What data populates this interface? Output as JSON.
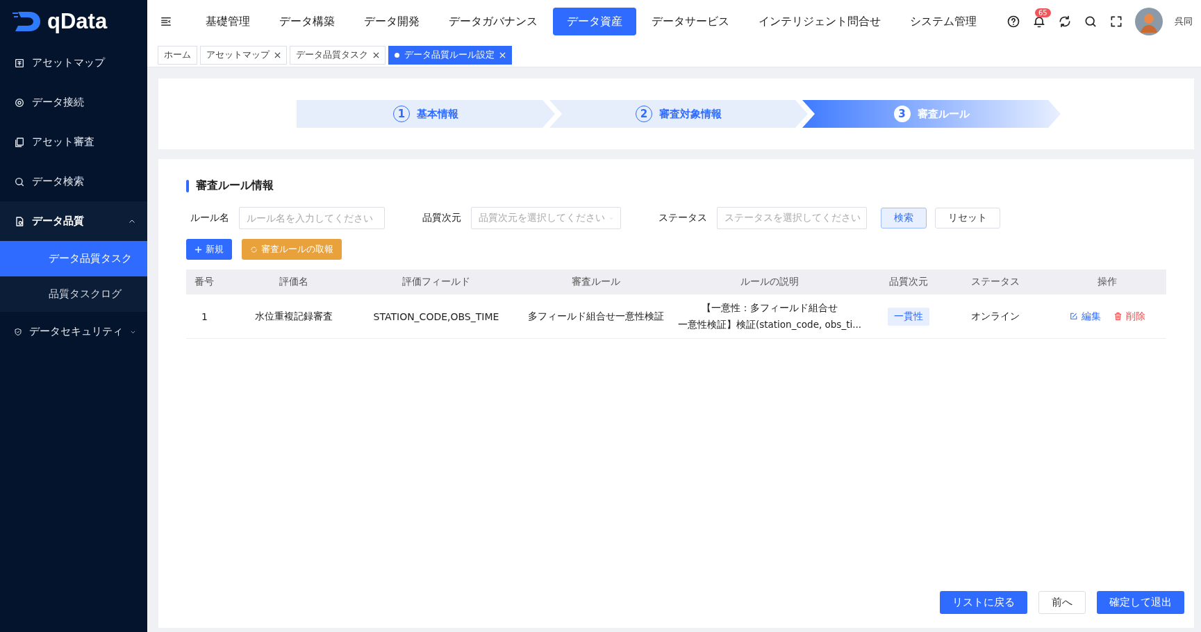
{
  "logo": {
    "text": "qData"
  },
  "nav": [
    {
      "label": "基礎管理",
      "selected": false
    },
    {
      "label": "データ構築",
      "selected": false
    },
    {
      "label": "データ開発",
      "selected": false
    },
    {
      "label": "データガバナンス",
      "selected": false
    },
    {
      "label": "データ資産",
      "selected": true
    },
    {
      "label": "データサービス",
      "selected": false
    },
    {
      "label": "インテリジェント問合せ",
      "selected": false
    },
    {
      "label": "システム管理",
      "selected": false
    }
  ],
  "header": {
    "notification_count": "65",
    "user": "呉同"
  },
  "sidebar": {
    "items": [
      {
        "label": "アセットマップ"
      },
      {
        "label": "データ接続"
      },
      {
        "label": "アセット審査"
      },
      {
        "label": "データ検索"
      },
      {
        "label": "データ品質",
        "expanded": true,
        "children": [
          {
            "label": "データ品質タスク",
            "selected": true
          },
          {
            "label": "品質タスクログ",
            "selected": false
          }
        ]
      },
      {
        "label": "データセキュリティ",
        "expanded": false
      }
    ]
  },
  "page_tabs": [
    {
      "label": "ホーム",
      "closable": false,
      "selected": false
    },
    {
      "label": "アセットマップ",
      "closable": true,
      "selected": false
    },
    {
      "label": "データ品質タスク",
      "closable": true,
      "selected": false
    },
    {
      "label": "データ品質ルール設定",
      "closable": true,
      "selected": true
    }
  ],
  "steps": [
    {
      "number": "1",
      "label": "基本情報",
      "selected": false
    },
    {
      "number": "2",
      "label": "審査対象情報",
      "selected": false
    },
    {
      "number": "3",
      "label": "審査ルール",
      "selected": true
    }
  ],
  "section": {
    "title": "審査ルール情報"
  },
  "filters": [
    {
      "label": "ルール名",
      "kind": "input",
      "placeholder": "ルール名を入力してください"
    },
    {
      "label": "品質次元",
      "kind": "select",
      "placeholder": "品質次元を選択してください"
    },
    {
      "label": "ステータス",
      "kind": "select",
      "placeholder": "ステータスを選択してください"
    }
  ],
  "filter_buttons": {
    "search": "検索",
    "reset": "リセット"
  },
  "actions": {
    "new": "新規",
    "fetch": "審査ルールの取報"
  },
  "table": {
    "columns": [
      "番号",
      "評価名",
      "評価フィールド",
      "審査ルール",
      "ルールの説明",
      "品質次元",
      "ステータス",
      "操作"
    ],
    "rows": [
      {
        "number": "1",
        "name": "水位重複記録審査",
        "fields": "STATION_CODE,OBS_TIME",
        "rule": "多フィールド組合せ一意性検証",
        "description": [
          "【一意性：多フィールド組合せ",
          "一意性検証】検証(station_code, obs_ti..."
        ],
        "dimension": "一貫性",
        "status": "オンライン",
        "edit": "編集",
        "delete": "削除"
      }
    ]
  },
  "footer_buttons": {
    "back": "リストに戻る",
    "prev": "前へ",
    "confirm": "確定して退出"
  }
}
